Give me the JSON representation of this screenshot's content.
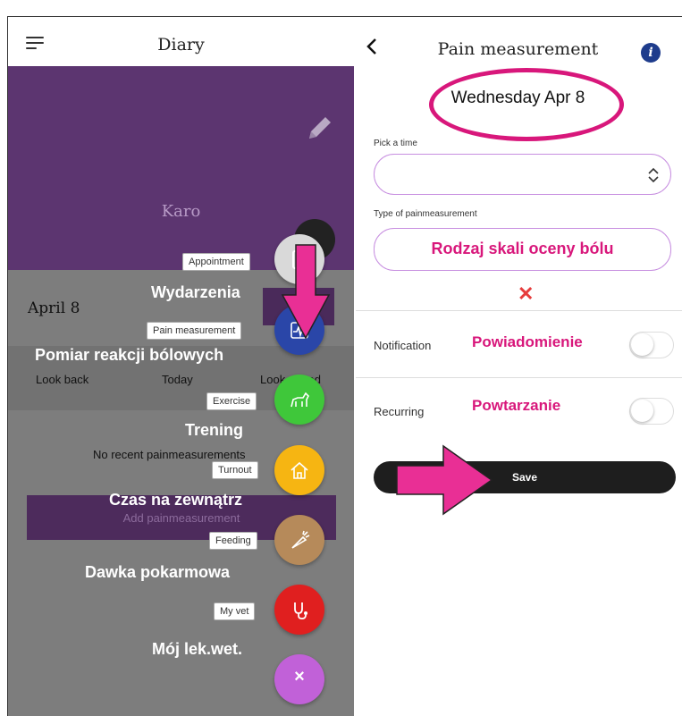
{
  "left": {
    "title": "Diary",
    "name": "Karo",
    "date": "April 8",
    "tabs": [
      "Look back",
      "Today",
      "Look ahead"
    ],
    "empty_text": "No recent painmeasurements",
    "add_label": "Add painmeasurement",
    "menu": [
      {
        "chip": "Appointment",
        "polish": "Wydarzenia",
        "color": "#d9d9d9",
        "icon": "clipboard-icon"
      },
      {
        "chip": "Pain measurement",
        "polish": "Pomiar reakcji bólowych",
        "color": "#2a46a8",
        "icon": "heart-rate-icon"
      },
      {
        "chip": "Exercise",
        "polish": "Trening",
        "color": "#3fc73a",
        "icon": "horse-icon"
      },
      {
        "chip": "Turnout",
        "polish": "Czas na zewnątrz",
        "color": "#f6b512",
        "icon": "home-icon"
      },
      {
        "chip": "Feeding",
        "polish": "Dawka pokarmowa",
        "color": "#b68a5a",
        "icon": "carrot-icon"
      },
      {
        "chip": "My vet",
        "polish": "Mój lek.wet.",
        "color": "#e01f1f",
        "icon": "stethoscope-icon"
      }
    ],
    "close_fab_color": "#c161d8",
    "close_symbol": "×"
  },
  "right": {
    "title": "Pain measurement",
    "info_symbol": "i",
    "date": "Wednesday Apr 8",
    "time_label": "Pick a time",
    "time_value": "",
    "type_label": "Type of painmeasurement",
    "type_polish": "Rodzaj skali oceny bólu",
    "clear_symbol": "✕",
    "notification_label": "Notification",
    "notification_polish": "Powiadomienie",
    "notification_on": false,
    "recurring_label": "Recurring",
    "recurring_polish": "Powtarzanie",
    "recurring_on": false,
    "save_label": "Save"
  },
  "colors": {
    "purple": "#5c3570",
    "annotation_pink": "#d8177b",
    "field_border": "#c78ee0"
  }
}
